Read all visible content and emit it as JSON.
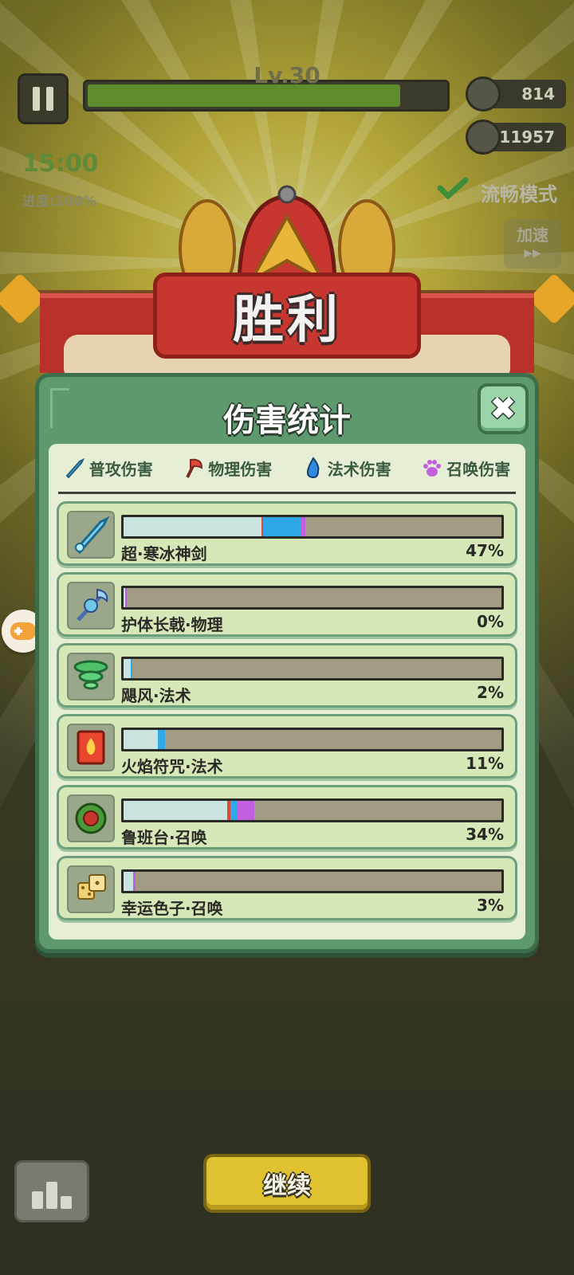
{
  "hud": {
    "level": "Lv.30",
    "level_progress": 0.88,
    "coins": "814",
    "kills": "11957",
    "timer": "15:00",
    "progress": "进度:100%",
    "mode": "流畅模式",
    "speed": "加速",
    "speed_arrows": "▶▶"
  },
  "banner": {
    "title": "胜利"
  },
  "modal": {
    "title": "伤害统计",
    "close": "✖",
    "legend": [
      {
        "label": "普攻伤害",
        "color": "#4fb6e8",
        "icon": "sword-icon"
      },
      {
        "label": "物理伤害",
        "color": "#e0493a",
        "icon": "axe-icon"
      },
      {
        "label": "法术伤害",
        "color": "#2e8be0",
        "icon": "flame-icon"
      },
      {
        "label": "召唤伤害",
        "color": "#c25fe0",
        "icon": "paw-icon"
      }
    ],
    "rows": [
      {
        "name": "超·寒冰神剑",
        "percent": "47%",
        "icon": "ice-sword-icon",
        "segments": [
          {
            "color": "#c9e3e0",
            "value": 0.365
          },
          {
            "color": "#e0493a",
            "value": 0.005
          },
          {
            "color": "#2fa8e6",
            "value": 0.1
          },
          {
            "color": "#c25fe0",
            "value": 0.01
          }
        ]
      },
      {
        "name": "护体长戟·物理",
        "percent": "0%",
        "icon": "halberd-icon",
        "segments": [
          {
            "color": "#c9e3e0",
            "value": 0.005
          },
          {
            "color": "#c25fe0",
            "value": 0.004
          }
        ]
      },
      {
        "name": "飓风·法术",
        "percent": "2%",
        "icon": "tornado-icon",
        "segments": [
          {
            "color": "#c9e3e0",
            "value": 0.018
          },
          {
            "color": "#2fa8e6",
            "value": 0.006
          }
        ]
      },
      {
        "name": "火焰符咒·法术",
        "percent": "11%",
        "icon": "fire-talisman-icon",
        "segments": [
          {
            "color": "#c9e3e0",
            "value": 0.09
          },
          {
            "color": "#2fa8e6",
            "value": 0.02
          }
        ]
      },
      {
        "name": "鲁班台·召唤",
        "percent": "34%",
        "icon": "luban-platform-icon",
        "segments": [
          {
            "color": "#c9e3e0",
            "value": 0.275
          },
          {
            "color": "#e0493a",
            "value": 0.008
          },
          {
            "color": "#2fa8e6",
            "value": 0.017
          },
          {
            "color": "#c25fe0",
            "value": 0.045
          }
        ]
      },
      {
        "name": "幸运色子·召唤",
        "percent": "3%",
        "icon": "lucky-dice-icon",
        "segments": [
          {
            "color": "#c9e3e0",
            "value": 0.025
          },
          {
            "color": "#c25fe0",
            "value": 0.006
          }
        ]
      }
    ]
  },
  "bottom": {
    "continue": "继续"
  }
}
